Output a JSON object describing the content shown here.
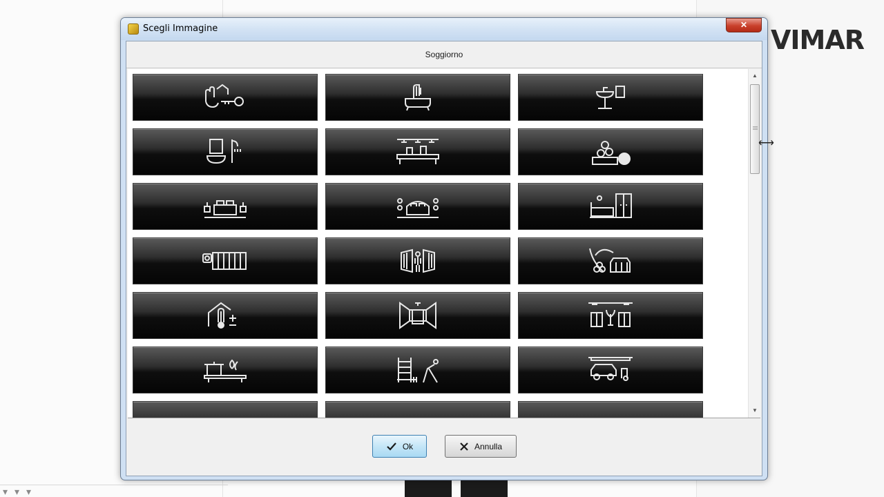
{
  "window": {
    "title": "Scegli Immagine",
    "close_glyph": "✕"
  },
  "room_label": "Soggiorno",
  "logo": {
    "text": "VIMAR"
  },
  "buttons": {
    "ok_label": "Ok",
    "ok_icon": "checkmark-icon",
    "cancel_label": "Annulla",
    "cancel_icon": "x-icon"
  },
  "colors": {
    "tile_icon": "#e8e8e8",
    "tile_bg_dark": "#050505",
    "tile_bg_light": "#5a5a5a",
    "accent": "#3c7fb1"
  },
  "tiles": [
    {
      "icon": "house-key-hand-icon"
    },
    {
      "icon": "bathtub-shower-icon"
    },
    {
      "icon": "washbasin-towel-icon"
    },
    {
      "icon": "bathroom-mirror-sink-shower-icon"
    },
    {
      "icon": "kitchen-counter-lamps-icon"
    },
    {
      "icon": "toys-ball-icon"
    },
    {
      "icon": "bedroom-double-bed-icon"
    },
    {
      "icon": "bedroom-bed-lamps-icon"
    },
    {
      "icon": "bedroom-wardrobe-icon"
    },
    {
      "icon": "sliding-gate-camera-icon"
    },
    {
      "icon": "person-gate-icon"
    },
    {
      "icon": "garden-sprinkler-icon"
    },
    {
      "icon": "house-thermometer-icon"
    },
    {
      "icon": "corridor-icon"
    },
    {
      "icon": "hallway-plant-doors-icon"
    },
    {
      "icon": "kitchen-cooking-pot-icon"
    },
    {
      "icon": "gym-equipment-icon"
    },
    {
      "icon": "garage-car-scooter-icon"
    },
    {
      "icon": "partial-tile-icon"
    },
    {
      "icon": "partial-tile-icon"
    },
    {
      "icon": "partial-tile-icon"
    }
  ],
  "scrollbar": {
    "up_glyph": "▲",
    "down_glyph": "▼"
  }
}
